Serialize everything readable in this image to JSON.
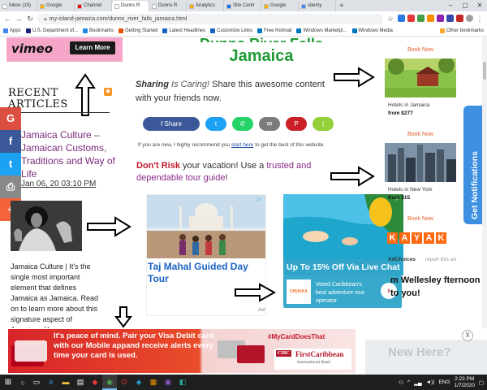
{
  "browser": {
    "tabs": [
      {
        "label": "Inbox (15)",
        "color": "#ffffff",
        "active": false
      },
      {
        "label": "Google",
        "color": "#f4b400",
        "active": false
      },
      {
        "label": "Channel",
        "color": "#ff0000",
        "active": false
      },
      {
        "label": "Dunns R",
        "color": "#f8f8f8",
        "active": true
      },
      {
        "label": "Dunns R",
        "color": "#f8f8f8",
        "active": false
      },
      {
        "label": "Analytics",
        "color": "#f9ab00",
        "active": false
      },
      {
        "label": "Site Centr",
        "color": "#1a73e8",
        "active": false
      },
      {
        "label": "Google",
        "color": "#f4b400",
        "active": false
      },
      {
        "label": "sitemy",
        "color": "#4285f4",
        "active": false
      }
    ],
    "new_tab": "+",
    "window_controls": [
      "–",
      "▢",
      "✕"
    ],
    "url": "my-island-jamaica.com/dunns_river_falls_jamaica.html",
    "bookmarks": [
      "Apps",
      "U.S. Department of...",
      "Bookmarks",
      "Getting Started",
      "Latest Headlines",
      "Customize Links",
      "Free Hotmail",
      "Windows Marketpl...",
      "Windows Media"
    ],
    "other_bookmarks": "Other bookmarks"
  },
  "left": {
    "vimeo_logo": "vimeo",
    "vimeo_button": "Learn More",
    "recent_heading": "RECENT ARTICLES",
    "article_link": "Jamaica Culture – Jamaican Customs, Traditions and Way of Life",
    "article_date": "Jan 06, 20 03:10 PM",
    "article_text": "Jamaica Culture | It's the single most important element that defines Jamaica as Jamaica. Read on to learn more about this signature aspect of Jamaican life.",
    "share_rail": [
      {
        "icon": "G",
        "color": "#dc4e41"
      },
      {
        "icon": "f",
        "color": "#3b5998"
      },
      {
        "icon": "t",
        "color": "#1da1f2"
      },
      {
        "icon": "⎙",
        "color": "#888888"
      },
      {
        "icon": "+",
        "color": "#f4643c"
      }
    ]
  },
  "center": {
    "title": "Jamaica",
    "sharing_lead": "Sharing",
    "sharing_is": "Is Caring!",
    "sharing_rest": "Share this awesome content with your friends now.",
    "share_buttons": [
      {
        "label": "f  Share",
        "color": "#3b5998",
        "w": 70
      },
      {
        "label": "t",
        "color": "#1da1f2",
        "w": 26
      },
      {
        "label": "✆",
        "color": "#25d366",
        "w": 26
      },
      {
        "label": "✉",
        "color": "#7b7b7b",
        "w": 26
      },
      {
        "label": "P",
        "color": "#cb2027",
        "w": 26
      },
      {
        "label": "⟨",
        "color": "#95d03a",
        "w": 26
      }
    ],
    "new_note_pre": "If you are new, I highly recommend you",
    "new_note_link": "start here",
    "new_note_post": "to get the best of this website.",
    "risk_bold": "Don't Risk",
    "risk_text": "your vacation! Use a",
    "risk_link": "trusted and dependable tour guide",
    "risk_end": "!",
    "ad1_title": "Taj Mahal Guided Day Tour",
    "ad2_headline": "Up To 15% Off Via Live Chat",
    "ad2_brand": "CHUKKA",
    "ad2_text": "Voted Caribbean's best adventure tour operator",
    "ad_label": "Ad"
  },
  "right": {
    "book_now": "Book Now",
    "hotel1_label": "Hotels in Jamaica",
    "hotel1_price": "from $277",
    "hotel2_label": "Hotels in New York",
    "hotel2_price": "from $15",
    "kayak_letters": [
      "K",
      "A",
      "Y",
      "A",
      "K"
    ],
    "report_prefix": "AdChoices",
    "report_ad": "report this ad",
    "welcome": "m Wellesley fternoon to you!",
    "notifications": "Get Notifications"
  },
  "banner": {
    "text": "It's peace of mind. Pair your Visa Debit card with our Mobile appand receive alerts every time your card is used.",
    "hashtag": "#MyCardDoesThat",
    "bank_logo": "CIBC",
    "bank_name": "FirstCaribbean",
    "bank_sub": "International Bank",
    "close": "X",
    "new_here": "New Here?"
  },
  "taskbar": {
    "time": "2:23 PM",
    "date": "1/7/2020",
    "lang": "ENG"
  }
}
